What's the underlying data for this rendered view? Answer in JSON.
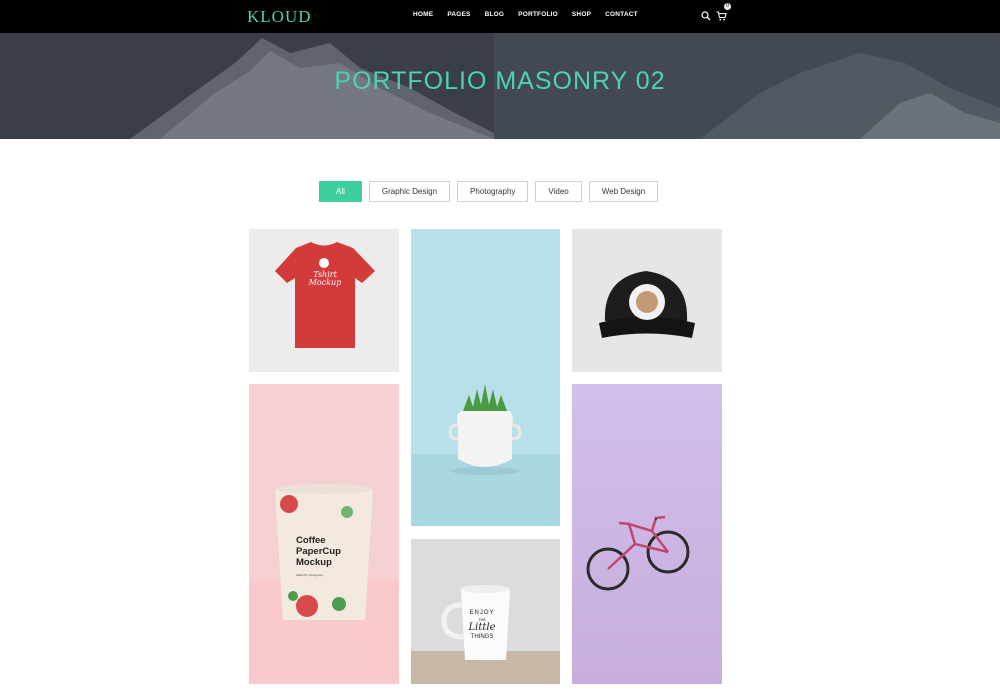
{
  "header": {
    "logo": "KLOUD",
    "nav": [
      "HOME",
      "PAGES",
      "BLOG",
      "PORTFOLIO",
      "SHOP",
      "CONTACT"
    ],
    "cart_count": "0"
  },
  "hero": {
    "title": "PORTFOLIO MASONRY 02"
  },
  "filters": [
    "All",
    "Graphic Design",
    "Photography",
    "Video",
    "Web Design"
  ],
  "portfolio": {
    "shirt": {
      "line1": "Tshirt",
      "line2": "Mockup"
    },
    "cup": {
      "line1": "Coffee",
      "line2": "PaperCup",
      "line3": "Mockup",
      "sub": "Made By Designsary"
    },
    "mug": {
      "line1": "ENJOY",
      "line2": "THE",
      "line3": "Little",
      "line4": "THINGS"
    }
  },
  "colors": {
    "accent": "#3dcf9f",
    "logo": "#4fd1b3"
  }
}
